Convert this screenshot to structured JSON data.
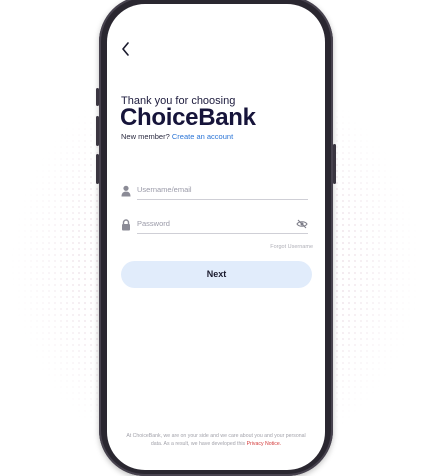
{
  "header": {
    "back_icon": "chevron-left-icon"
  },
  "welcome": {
    "greeting": "Thank you for choosing",
    "brand": "ChoiceBank",
    "new_member_text": "New member?",
    "create_account_link": "Create an account"
  },
  "form": {
    "username_placeholder": "Username/email",
    "username_icon": "user-icon",
    "password_placeholder": "Password",
    "password_icon": "lock-icon",
    "visibility_icon": "eye-off-icon",
    "forgot_username": "Forgot Username",
    "next_label": "Next"
  },
  "footer": {
    "notice_text": "At ChoiceBank, we are on your side and we care about you and your personal data. As a result, we have developed this",
    "privacy_link": "Privacy Notice."
  },
  "colors": {
    "brand": "#16143a",
    "link": "#2a74d6",
    "button_bg": "#e1ecfb",
    "privacy": "#d33a3a"
  }
}
